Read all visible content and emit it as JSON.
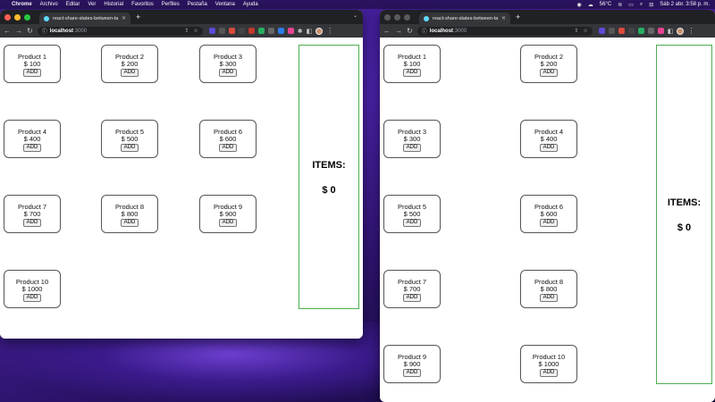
{
  "menubar": {
    "apple": "",
    "app": "Chrome",
    "items": [
      "Archivo",
      "Editar",
      "Ver",
      "Historial",
      "Favoritos",
      "Perfiles",
      "Pestaña",
      "Ventana",
      "Ayuda"
    ],
    "temperature": "56°C",
    "datetime": "Sáb 2 abr.  3:58 p. m."
  },
  "browser": {
    "tab_title": "react-share-states-between-tabs",
    "url_host": "localhost",
    "url_port": ":3000"
  },
  "left": {
    "products": [
      {
        "name": "Product 1",
        "price": "$ 100"
      },
      {
        "name": "Product 2",
        "price": "$ 200"
      },
      {
        "name": "Product 3",
        "price": "$ 300"
      },
      {
        "name": "Product 4",
        "price": "$ 400"
      },
      {
        "name": "Product 5",
        "price": "$ 500"
      },
      {
        "name": "Product 6",
        "price": "$ 600"
      },
      {
        "name": "Product 7",
        "price": "$ 700"
      },
      {
        "name": "Product 8",
        "price": "$ 800"
      },
      {
        "name": "Product 9",
        "price": "$ 900"
      },
      {
        "name": "Product 10",
        "price": "$ 1000"
      }
    ],
    "cart": {
      "label": "ITEMS:",
      "total": "$ 0"
    }
  },
  "right": {
    "products": [
      {
        "name": "Product 1",
        "price": "$ 100"
      },
      {
        "name": "Product 2",
        "price": "$ 200"
      },
      {
        "name": "Product 3",
        "price": "$ 300"
      },
      {
        "name": "Product 4",
        "price": "$ 400"
      },
      {
        "name": "Product 5",
        "price": "$ 500"
      },
      {
        "name": "Product 6",
        "price": "$ 600"
      },
      {
        "name": "Product 7",
        "price": "$ 700"
      },
      {
        "name": "Product 8",
        "price": "$ 800"
      },
      {
        "name": "Product 9",
        "price": "$ 900"
      },
      {
        "name": "Product 10",
        "price": "$ 1000"
      }
    ],
    "cart": {
      "label": "ITEMS:",
      "total": "$ 0"
    }
  },
  "add_label": "ADD",
  "colors": {
    "cart_border": "#4caf50",
    "tab_bar": "#202124",
    "toolbar": "#35363a"
  }
}
